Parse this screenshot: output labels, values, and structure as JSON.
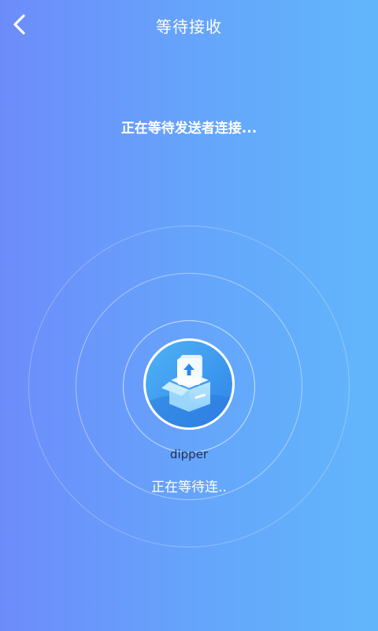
{
  "header": {
    "title": "等待接收",
    "back_icon": "chevron-left-icon"
  },
  "status": {
    "text": "正在等待发送者连接..."
  },
  "device": {
    "name": "dipper",
    "status": "正在等待连..",
    "icon": "upload-box-icon"
  },
  "colors": {
    "gradient_start": "#6d8cfb",
    "gradient_end": "#61b6fb",
    "avatar_blue": "#3aa0f2",
    "device_name": "#1f3056"
  }
}
